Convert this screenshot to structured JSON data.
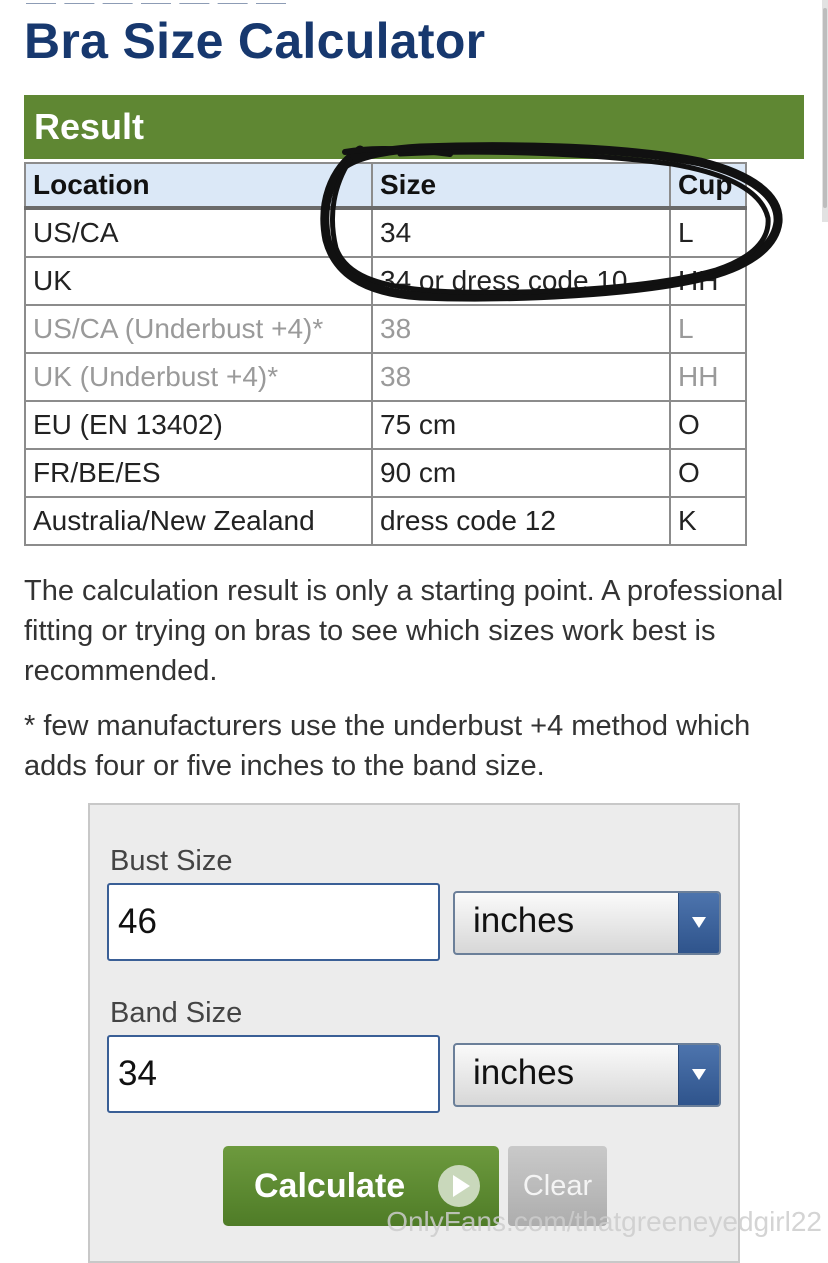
{
  "page": {
    "title": "Bra Size Calculator"
  },
  "result": {
    "header": "Result",
    "columns": [
      "Location",
      "Size",
      "Cup"
    ],
    "rows": [
      {
        "location": "US/CA",
        "size": "34",
        "cup": "L",
        "muted": false
      },
      {
        "location": "UK",
        "size": "34 or dress code 10",
        "cup": "HH",
        "muted": false
      },
      {
        "location": "US/CA (Underbust +4)*",
        "size": "38",
        "cup": "L",
        "muted": true
      },
      {
        "location": "UK (Underbust +4)*",
        "size": "38",
        "cup": "HH",
        "muted": true
      },
      {
        "location": "EU (EN 13402)",
        "size": "75 cm",
        "cup": "O",
        "muted": false
      },
      {
        "location": "FR/BE/ES",
        "size": "90 cm",
        "cup": "O",
        "muted": false
      },
      {
        "location": "Australia/New Zealand",
        "size": "dress code 12",
        "cup": "K",
        "muted": false
      }
    ]
  },
  "notes": {
    "starting_point": "The calculation result is only a starting point. A professional fitting or trying on bras to see which sizes work best is recommended.",
    "underbust": "* few manufacturers use the underbust +4 method which adds four or five inches to the band size."
  },
  "form": {
    "bust": {
      "label": "Bust Size",
      "value": "46",
      "unit": "inches"
    },
    "band": {
      "label": "Band Size",
      "value": "34",
      "unit": "inches"
    },
    "calculate_label": "Calculate",
    "clear_label": "Clear"
  },
  "watermark": "OnlyFans.com/thatgreeneyedgirl22",
  "colors": {
    "title": "#17386e",
    "result_header": "#5f8733",
    "table_header": "#dbe8f7",
    "muted_text": "#9a9a9a",
    "select_arrow": "#3a6299",
    "calculate": "#5a8a30",
    "clear": "#bcbcbc",
    "scribble": "#111111"
  },
  "icons": {
    "select_arrow": "triangle-down-icon",
    "calculate": "play-circle-icon",
    "annotation": "hand-drawn-circle-scribble"
  }
}
